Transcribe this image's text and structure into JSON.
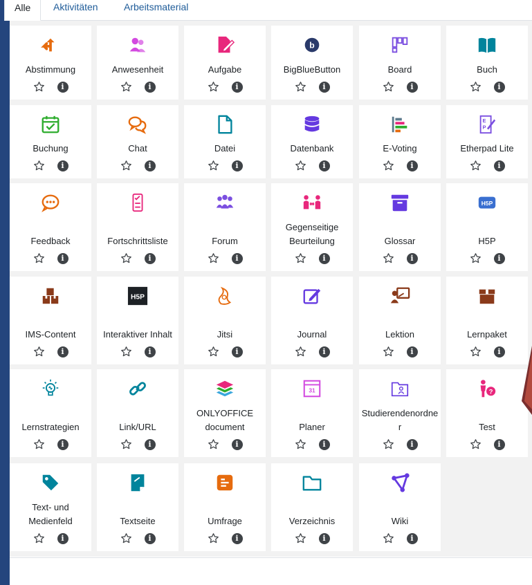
{
  "tabs": [
    {
      "label": "Alle",
      "active": true
    },
    {
      "label": "Aktivitäten",
      "active": false
    },
    {
      "label": "Arbeitsmaterial",
      "active": false
    }
  ],
  "activities": [
    {
      "label": "Abstimmung",
      "icon": "split-arrow-icon",
      "color": "#e66b0e"
    },
    {
      "label": "Anwesenheit",
      "icon": "people-icon",
      "color": "#d34ae0"
    },
    {
      "label": "Aufgabe",
      "icon": "file-edit-icon",
      "color": "#e8277c"
    },
    {
      "label": "BigBlueButton",
      "icon": "bigbluebutton-icon",
      "color": "#2a3a6a"
    },
    {
      "label": "Board",
      "icon": "board-icon",
      "color": "#7b4fe0"
    },
    {
      "label": "Buch",
      "icon": "book-icon",
      "color": "#00849c"
    },
    {
      "label": "Buchung",
      "icon": "calendar-check-icon",
      "color": "#2dac2d"
    },
    {
      "label": "Chat",
      "icon": "chat-icon",
      "color": "#e66b0e"
    },
    {
      "label": "Datei",
      "icon": "file-icon",
      "color": "#00849c"
    },
    {
      "label": "Datenbank",
      "icon": "database-icon",
      "color": "#6439e0"
    },
    {
      "label": "E-Voting",
      "icon": "bar-chart-icon",
      "color": "#5c7a8c"
    },
    {
      "label": "Etherpad Lite",
      "icon": "etherpad-icon",
      "color": "#7b4fe0"
    },
    {
      "label": "Feedback",
      "icon": "feedback-icon",
      "color": "#e66b0e"
    },
    {
      "label": "Fortschrittsliste",
      "icon": "checklist-icon",
      "color": "#e8277c"
    },
    {
      "label": "Forum",
      "icon": "forum-icon",
      "color": "#7b4fe0"
    },
    {
      "label": "Gegenseitige Beurteilung",
      "icon": "peer-review-icon",
      "color": "#e8277c"
    },
    {
      "label": "Glossar",
      "icon": "archive-icon",
      "color": "#6439e0"
    },
    {
      "label": "H5P",
      "icon": "h5p-icon",
      "color": "#3a6fd0"
    },
    {
      "label": "IMS-Content",
      "icon": "boxes-icon",
      "color": "#8a3a1a"
    },
    {
      "label": "Interaktiver Inhalt",
      "icon": "h5p-black-icon",
      "color": "#1d2125"
    },
    {
      "label": "Jitsi",
      "icon": "jitsi-icon",
      "color": "#e66b0e"
    },
    {
      "label": "Journal",
      "icon": "journal-icon",
      "color": "#6439e0"
    },
    {
      "label": "Lektion",
      "icon": "lesson-icon",
      "color": "#8a3a1a"
    },
    {
      "label": "Lernpaket",
      "icon": "package-icon",
      "color": "#8a3a1a"
    },
    {
      "label": "Lernstrategien",
      "icon": "lightbulb-icon",
      "color": "#00849c"
    },
    {
      "label": "Link/URL",
      "icon": "link-icon",
      "color": "#00849c"
    },
    {
      "label": "ONLYOFFICE document",
      "icon": "onlyoffice-icon",
      "color": "#e8277c"
    },
    {
      "label": "Planer",
      "icon": "planner-icon",
      "color": "#d34ae0"
    },
    {
      "label": "Studierendenordner",
      "icon": "student-folder-icon",
      "color": "#6439e0"
    },
    {
      "label": "Test",
      "icon": "test-icon",
      "color": "#e8277c"
    },
    {
      "label": "Text- und Medienfeld",
      "icon": "tag-icon",
      "color": "#00849c"
    },
    {
      "label": "Textseite",
      "icon": "page-icon",
      "color": "#00849c"
    },
    {
      "label": "Umfrage",
      "icon": "survey-icon",
      "color": "#e66b0e"
    },
    {
      "label": "Verzeichnis",
      "icon": "folder-icon",
      "color": "#00849c"
    },
    {
      "label": "Wiki",
      "icon": "wiki-icon",
      "color": "#6439e0"
    }
  ],
  "info_glyph": "i"
}
